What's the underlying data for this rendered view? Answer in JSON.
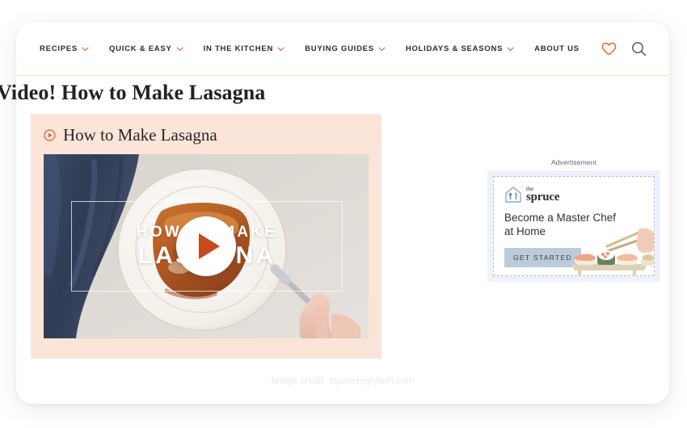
{
  "nav": {
    "items": [
      {
        "label": "RECIPES",
        "has_chevron": true
      },
      {
        "label": "QUICK & EASY",
        "has_chevron": true
      },
      {
        "label": "IN THE KITCHEN",
        "has_chevron": true
      },
      {
        "label": "BUYING GUIDES",
        "has_chevron": true
      },
      {
        "label": "HOLIDAYS & SEASONS",
        "has_chevron": true
      },
      {
        "label": "ABOUT US",
        "has_chevron": false
      }
    ],
    "actions": {
      "favorite_icon": "heart-icon",
      "search_icon": "search-icon"
    }
  },
  "page": {
    "title": "Video! How to Make Lasagna"
  },
  "video": {
    "heading": "How to Make Lasagna",
    "play_icon": "play-circle-icon",
    "overlay_line_1": "HOW TO MAKE",
    "overlay_line_2": "LASAGNA",
    "play_button": "play-button",
    "thumbnail_description": "Overhead photo of a slice of lasagna on a white plate with a fork, navy denim napkin"
  },
  "ad": {
    "label": "Advertisement",
    "logo_the": "the",
    "logo_name": "spruce",
    "logo_icon": "house-fork-knife-icon",
    "headline": "Become a Master Chef at Home",
    "cta_label": "GET STARTED",
    "art_description": "Sushi pieces on a board with chopsticks"
  },
  "footer": {
    "credit": "Image credit: squeezegrowth.com"
  },
  "colors": {
    "accent_orange": "#d9622b",
    "play_triangle": "#c8491b",
    "panel_peach": "#fbe4d8",
    "nav_divider": "#f7e6b8",
    "ad_frame": "#eef2fb",
    "cta_bg": "#bccbd9"
  }
}
